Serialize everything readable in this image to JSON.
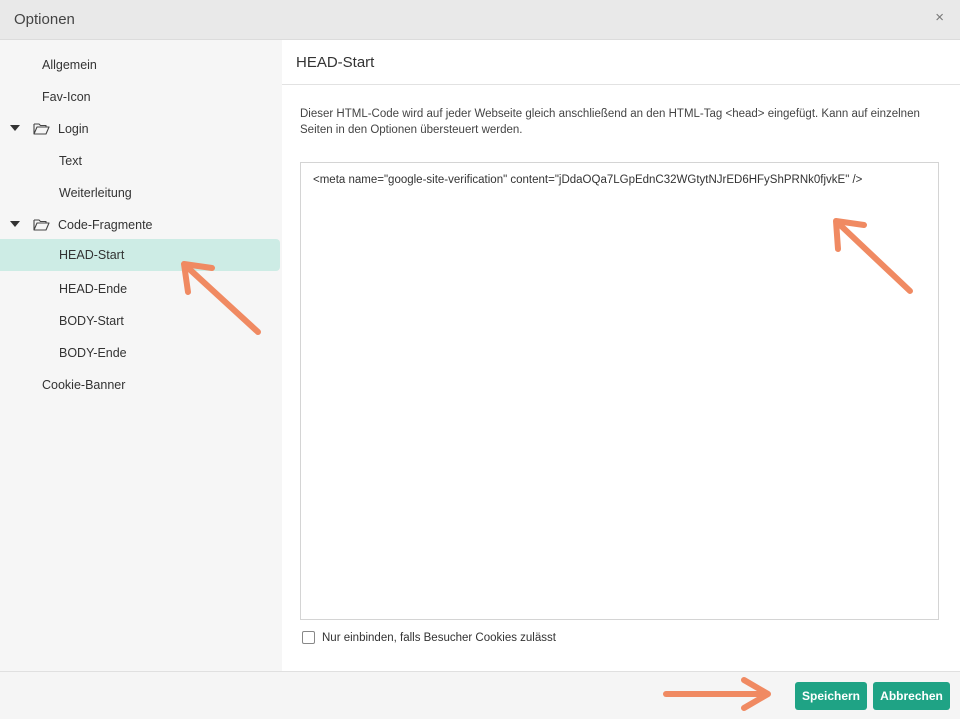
{
  "dialog": {
    "title": "Optionen",
    "close_symbol": "×"
  },
  "sidebar": {
    "items": [
      {
        "label": "Allgemein"
      },
      {
        "label": "Fav-Icon"
      },
      {
        "label": "Login",
        "expanded": true
      },
      {
        "label": "Text"
      },
      {
        "label": "Weiterleitung"
      },
      {
        "label": "Code-Fragmente",
        "expanded": true
      },
      {
        "label": "HEAD-Start",
        "selected": true
      },
      {
        "label": "HEAD-Ende"
      },
      {
        "label": "BODY-Start"
      },
      {
        "label": "BODY-Ende"
      },
      {
        "label": "Cookie-Banner"
      }
    ]
  },
  "main": {
    "heading": "HEAD-Start",
    "description": "Dieser HTML-Code wird auf jeder Webseite gleich anschließend an den HTML-Tag <head> eingefügt. Kann auf einzelnen Seiten in den Optionen übersteuert werden.",
    "code_value": "<meta name=\"google-site-verification\" content=\"jDdaOQa7LGpEdnC32WGtytNJrED6HFyShPRNk0fjvkE\" />",
    "checkbox_label": "Nur einbinden, falls Besucher Cookies zulässt",
    "checkbox_checked": false
  },
  "footer": {
    "save_label": "Speichern",
    "cancel_label": "Abbrechen"
  },
  "colors": {
    "accent": "#1fa385",
    "selected_bg": "#cdece5",
    "annotation_arrow": "#f08a62"
  },
  "icons": {
    "close": "close-icon",
    "caret": "caret-down-icon",
    "folder": "folder-open-icon",
    "annotation": "arrow-annotation-icon"
  }
}
